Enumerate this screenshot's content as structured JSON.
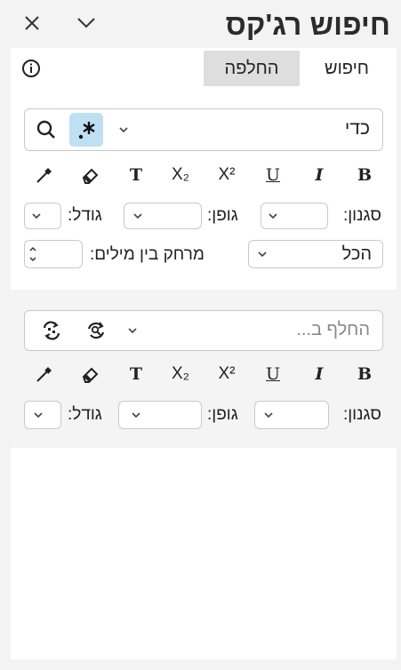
{
  "window": {
    "title": "חיפוש רג'קס",
    "close_icon": "close-icon",
    "collapse_icon": "chevron-down-icon"
  },
  "tabs": [
    {
      "label": "חיפוש",
      "active": false
    },
    {
      "label": "החלפה",
      "active": true
    }
  ],
  "info_icon": "info-icon",
  "find": {
    "value": "כדי",
    "search_icon": "search-icon",
    "regex_icon": "regex-icon",
    "format_buttons": [
      "B",
      "I",
      "U",
      "X²",
      "X₂",
      "T"
    ],
    "style_label": "סגנון:",
    "font_label": "גופן:",
    "size_label": "גודל:",
    "scope_value": "הכל",
    "word_spacing_label": "מרחק בין מילים:"
  },
  "replace": {
    "placeholder": "החלף ב...",
    "replace_icon": "replace-icon",
    "replace_all_icon": "replace-all-icon",
    "format_buttons": [
      "B",
      "I",
      "U",
      "X²",
      "X₂",
      "T"
    ],
    "style_label": "סגנון:",
    "font_label": "גופן:",
    "size_label": "גודל:"
  },
  "colors": {
    "accent": "#bfe0f3",
    "active_tab": "#dedede"
  }
}
